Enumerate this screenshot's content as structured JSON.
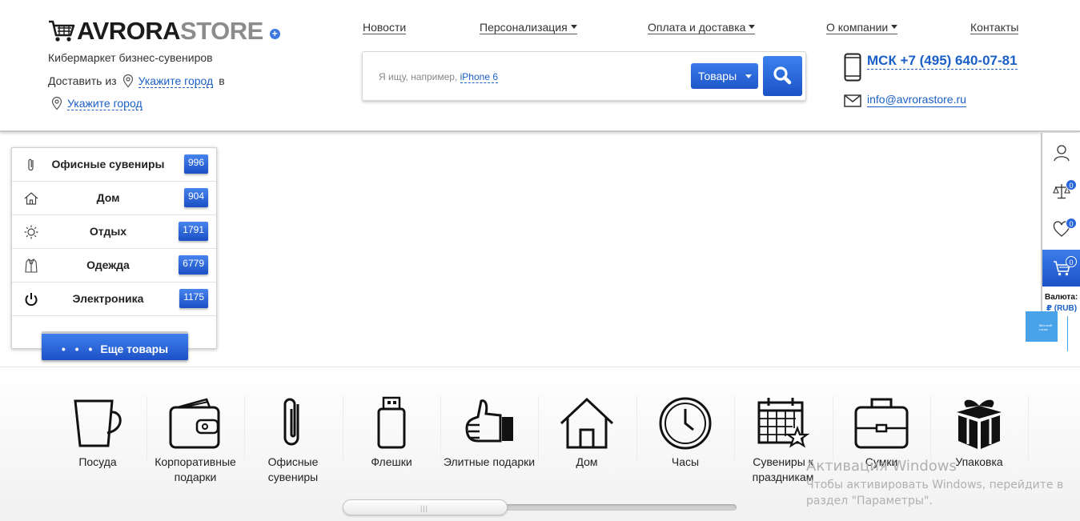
{
  "logo": {
    "part1": "AVRORA",
    "part2": "STORE",
    "plus": "+"
  },
  "tagline": "Кибермаркет бизнес-сувениров",
  "delivery": {
    "prefix": "Доставить из",
    "city_from": "Укажите город",
    "middle": "в",
    "city_to": "Укажите город"
  },
  "nav": [
    {
      "label": "Новости",
      "dropdown": false
    },
    {
      "label": "Персонализация",
      "dropdown": true
    },
    {
      "label": "Оплата и доставка",
      "dropdown": true
    },
    {
      "label": "О компании",
      "dropdown": true
    },
    {
      "label": "Контакты",
      "dropdown": false
    }
  ],
  "search": {
    "placeholder": "Я ищу, например,",
    "example": "iPhone 6",
    "category": "Товары"
  },
  "contact": {
    "phone": "МСК +7 (495) 640-07-81",
    "email": "info@avrorastore.ru"
  },
  "categories": [
    {
      "label": "Офисные сувениры",
      "count": "996",
      "icon": "paperclip-icon"
    },
    {
      "label": "Дом",
      "count": "904",
      "icon": "home-icon"
    },
    {
      "label": "Отдых",
      "count": "1791",
      "icon": "sun-icon"
    },
    {
      "label": "Одежда",
      "count": "6779",
      "icon": "jacket-icon"
    },
    {
      "label": "Электроника",
      "count": "1175",
      "icon": "power-icon"
    }
  ],
  "more_button": {
    "dots": "• • •",
    "label": "Еще товары"
  },
  "sidebar": {
    "compare_count": "0",
    "favorites_count": "0",
    "cart_count": "0",
    "currency_label": "Валюта:",
    "currency_value": "₽ (RUB)"
  },
  "carousel": [
    {
      "label": "Посуда",
      "icon": "cup-icon"
    },
    {
      "label": "Корпоративные подарки",
      "icon": "wallet-icon"
    },
    {
      "label": "Офисные сувениры",
      "icon": "paperclip-icon"
    },
    {
      "label": "Флешки",
      "icon": "usb-flash-icon"
    },
    {
      "label": "Элитные подарки",
      "icon": "thumbs-up-icon"
    },
    {
      "label": "Дом",
      "icon": "house-icon"
    },
    {
      "label": "Часы",
      "icon": "clock-icon"
    },
    {
      "label": "Сувениры к праздникам",
      "icon": "calendar-star-icon"
    },
    {
      "label": "Сумки",
      "icon": "bag-icon"
    },
    {
      "label": "Упаковка",
      "icon": "gift-box-icon"
    }
  ],
  "scrollbar_position": 0,
  "windows_watermark": {
    "title": "Активация Windows",
    "text": "Чтобы активировать Windows, перейдите в раздел \"Параметры\"."
  },
  "ms_tile_text": "Microsoft Lense",
  "colors": {
    "accent": "#1a5fc7",
    "button_blue": "#2a67dc",
    "logo_dark": "#1b1b1b",
    "logo_gray": "#8c8c8c"
  }
}
